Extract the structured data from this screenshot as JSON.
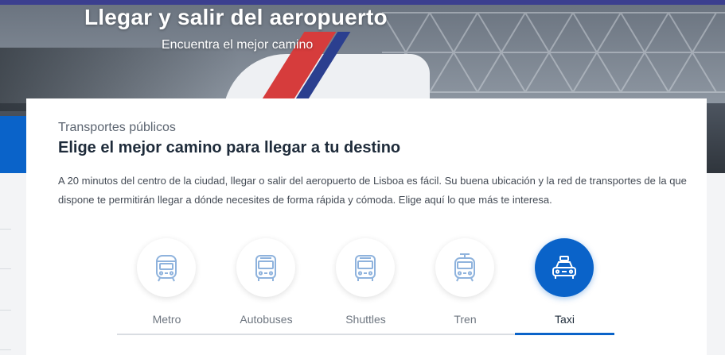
{
  "hero": {
    "title": "Llegar y salir del aeropuerto",
    "subtitle": "Encuentra el mejor camino"
  },
  "section": {
    "kicker": "Transportes públicos",
    "title": "Elige el mejor camino para llegar a tu destino",
    "intro": "A 20 minutos del centro de la ciudad, llegar o salir del aeropuerto de Lisboa es fácil. Su buena ubicación y la red de transportes de la que dispone te permitirán llegar a dónde necesites de forma rápida y cómoda. Elige aquí lo que más te interesa."
  },
  "tabs": [
    {
      "label": "Metro",
      "icon": "metro-icon",
      "active": false
    },
    {
      "label": "Autobuses",
      "icon": "bus-icon",
      "active": false
    },
    {
      "label": "Shuttles",
      "icon": "shuttle-icon",
      "active": false
    },
    {
      "label": "Tren",
      "icon": "train-icon",
      "active": false
    },
    {
      "label": "Taxi",
      "icon": "taxi-icon",
      "active": true
    }
  ],
  "colors": {
    "accent": "#0a63c9",
    "icon_outline": "#8fb3dd"
  }
}
